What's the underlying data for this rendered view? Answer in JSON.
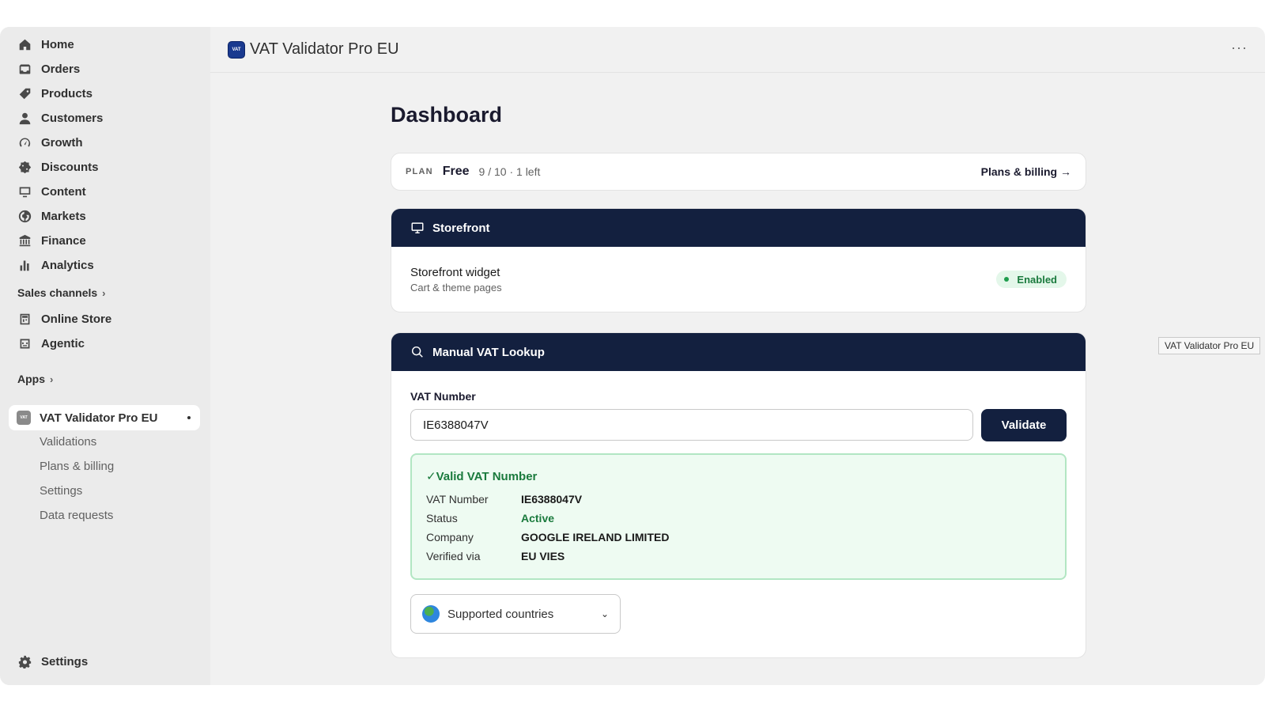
{
  "sidebar": {
    "nav": [
      {
        "label": "Home",
        "icon": "home-icon"
      },
      {
        "label": "Orders",
        "icon": "inbox-icon"
      },
      {
        "label": "Products",
        "icon": "tag-icon"
      },
      {
        "label": "Customers",
        "icon": "person-icon"
      },
      {
        "label": "Growth",
        "icon": "gauge-icon"
      },
      {
        "label": "Discounts",
        "icon": "discount-icon"
      },
      {
        "label": "Content",
        "icon": "monitor-icon"
      },
      {
        "label": "Markets",
        "icon": "globe-icon"
      },
      {
        "label": "Finance",
        "icon": "bank-icon"
      },
      {
        "label": "Analytics",
        "icon": "bar-chart-icon"
      }
    ],
    "sales_channels_label": "Sales channels",
    "channels": [
      {
        "label": "Online Store",
        "icon": "store-icon"
      },
      {
        "label": "Agentic",
        "icon": "robot-icon"
      }
    ],
    "apps_label": "Apps",
    "app": {
      "label": "VAT Validator Pro EU",
      "icon_text": "VAT"
    },
    "app_sub": [
      "Validations",
      "Plans & billing",
      "Settings",
      "Data requests"
    ],
    "settings_label": "Settings"
  },
  "header": {
    "title": "VAT Validator Pro EU",
    "logo_text": "VAT",
    "more": "···"
  },
  "page": {
    "title": "Dashboard"
  },
  "plan": {
    "label": "PLAN",
    "name": "Free",
    "usage": "9 / 10 · 1 left",
    "link": "Plans & billing →"
  },
  "storefront": {
    "header": "Storefront",
    "widget_title": "Storefront widget",
    "widget_sub": "Cart & theme pages",
    "status": "Enabled"
  },
  "lookup": {
    "header": "Manual VAT Lookup",
    "field_label": "VAT Number",
    "field_value": "IE6388047V",
    "button": "Validate",
    "result": {
      "title": "✓Valid VAT Number",
      "rows": [
        {
          "key": "VAT Number",
          "value": "IE6388047V"
        },
        {
          "key": "Status",
          "value": "Active"
        },
        {
          "key": "Company",
          "value": "GOOGLE IRELAND LIMITED"
        },
        {
          "key": "Verified via",
          "value": "EU VIES"
        }
      ]
    },
    "countries_label": "Supported countries"
  },
  "tooltip": "VAT Validator Pro EU",
  "colors": {
    "navy": "#13203f",
    "success": "#1a7a3d",
    "success_bg": "#eefbf2"
  }
}
